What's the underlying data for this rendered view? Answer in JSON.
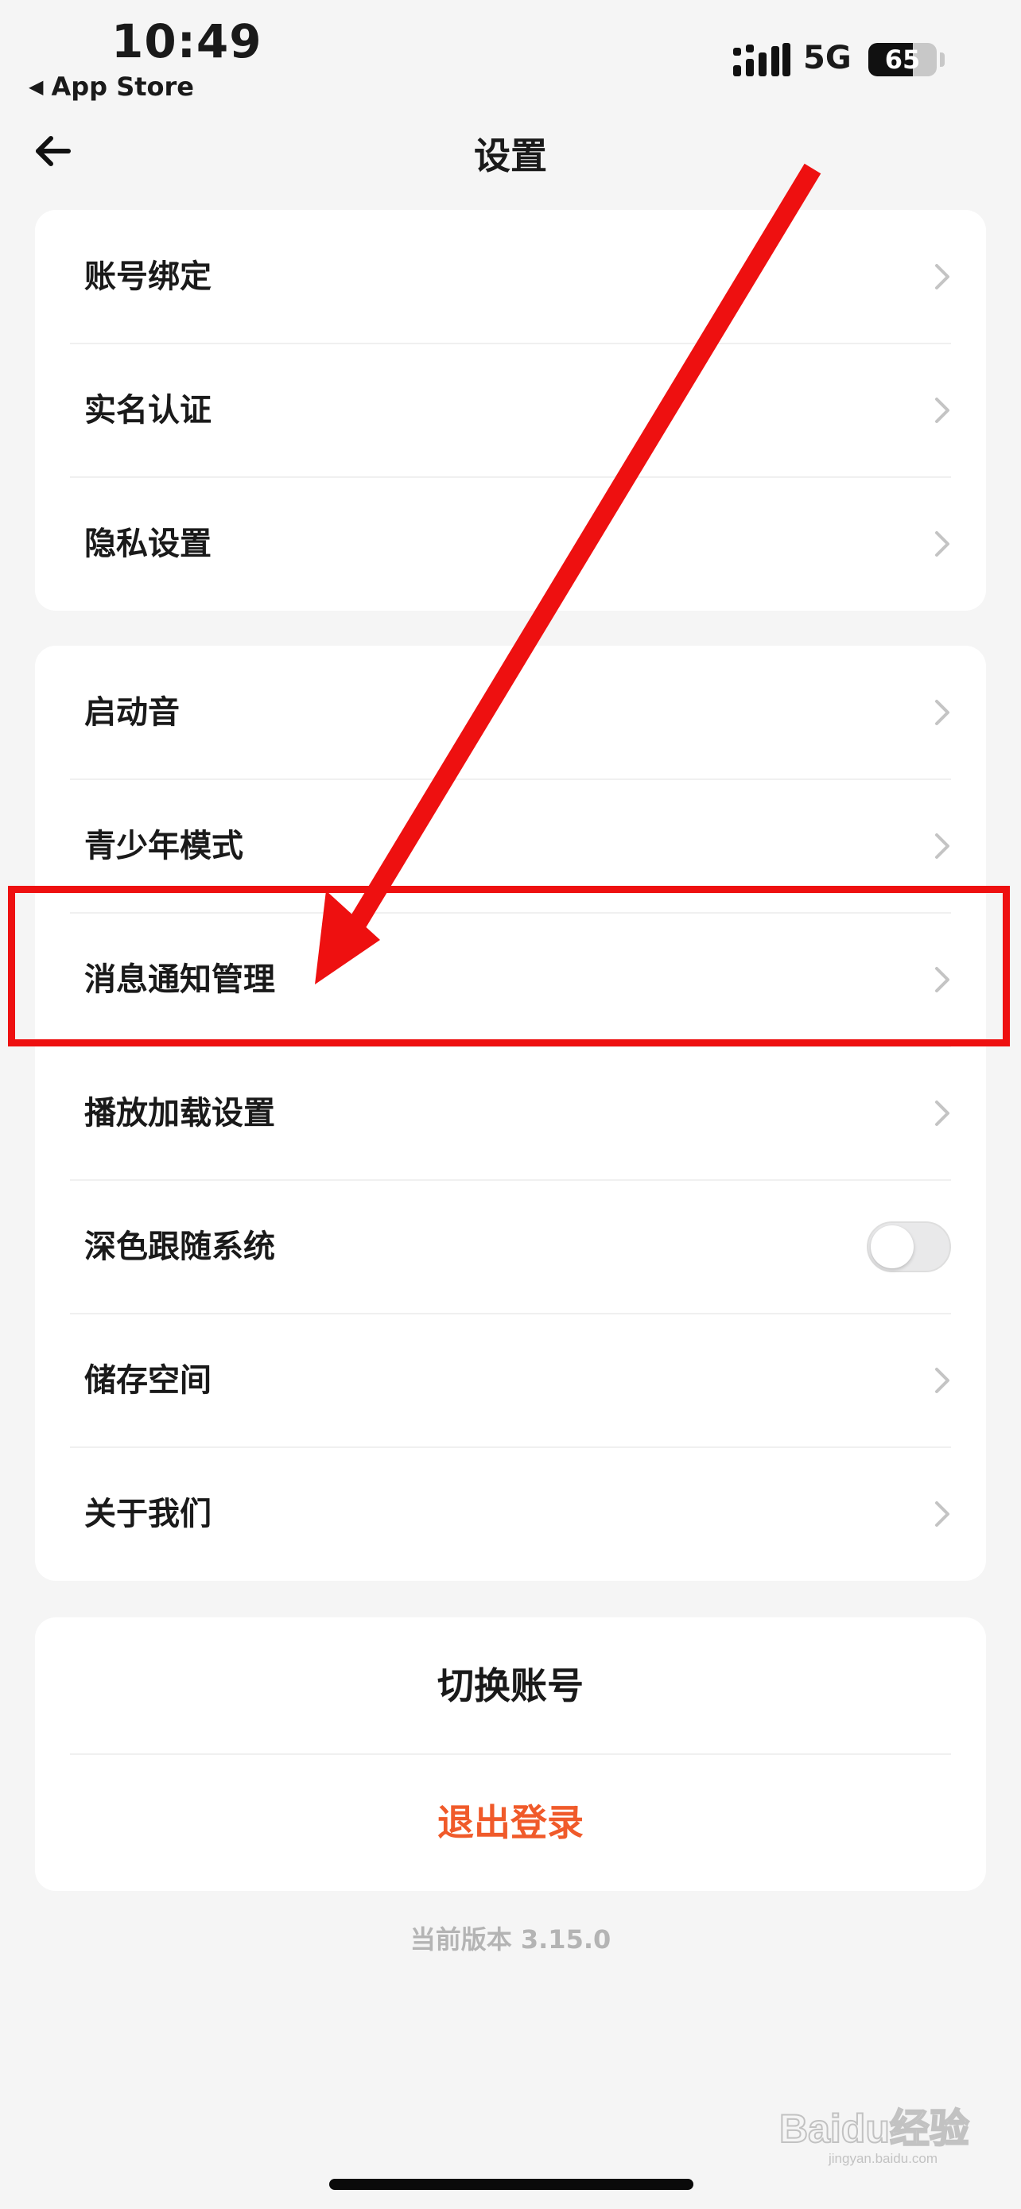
{
  "status_bar": {
    "time": "10:49",
    "back_app": "App Store",
    "network": "5G",
    "battery": "65",
    "battery_level": 0.65
  },
  "nav": {
    "title": "设置"
  },
  "group1": {
    "items": [
      {
        "label": "账号绑定"
      },
      {
        "label": "实名认证"
      },
      {
        "label": "隐私设置"
      }
    ]
  },
  "group2": {
    "items": [
      {
        "label": "启动音"
      },
      {
        "label": "青少年模式"
      },
      {
        "label": "消息通知管理"
      },
      {
        "label": "播放加载设置"
      },
      {
        "label": "深色跟随系统",
        "toggle_on": false
      },
      {
        "label": "储存空间"
      },
      {
        "label": "关于我们"
      }
    ]
  },
  "account": {
    "switch_label": "切换账号",
    "logout_label": "退出登录"
  },
  "footer": {
    "version": "当前版本 3.15.0",
    "watermark": "Baidu经验",
    "watermark_sub": "jingyan.baidu.com"
  },
  "colors": {
    "background": "#f5f5f5",
    "card": "#ffffff",
    "logout": "#f05a2a",
    "annotation": "#ee1010",
    "chevron": "#c4c4c4"
  }
}
